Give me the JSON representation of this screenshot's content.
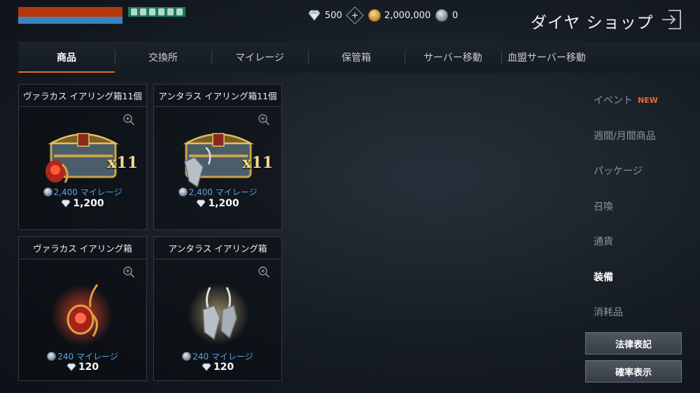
{
  "status": {
    "diamonds": "500",
    "gold": "2,000,000",
    "mileage": "0"
  },
  "header": {
    "title": "ダイヤ ショップ"
  },
  "tabs": [
    {
      "label": "商品",
      "active": true
    },
    {
      "label": "交換所"
    },
    {
      "label": "マイレージ"
    },
    {
      "label": "保管箱"
    },
    {
      "label": "サーバー移動"
    },
    {
      "label": "血盟サーバー移動"
    }
  ],
  "products": [
    {
      "name": "ヴァラカス イアリング箱11個",
      "mileage": "2,400 マイレージ",
      "price": "1,200",
      "badge": "x11",
      "image": "red-earring-chest"
    },
    {
      "name": "アンタラス イアリング箱11個",
      "mileage": "2,400 マイレージ",
      "price": "1,200",
      "badge": "x11",
      "image": "silver-earring-chest"
    },
    {
      "name": "ヴァラカス イアリング箱",
      "mileage": "240 マイレージ",
      "price": "120",
      "image": "red-earring"
    },
    {
      "name": "アンタラス イアリング箱",
      "mileage": "240 マイレージ",
      "price": "120",
      "image": "silver-earring"
    }
  ],
  "categories": [
    {
      "label": "イベント",
      "badge": "NEW"
    },
    {
      "label": "週間/月間商品"
    },
    {
      "label": "パッケージ"
    },
    {
      "label": "召喚"
    },
    {
      "label": "通貨"
    },
    {
      "label": "装備",
      "active": true
    },
    {
      "label": "消耗品"
    }
  ],
  "buttons": {
    "legal": "法律表記",
    "probability": "確率表示"
  },
  "colors": {
    "accent": "#e0722a",
    "mileage_text": "#5aa2e6",
    "new_badge": "#e96b2a"
  }
}
